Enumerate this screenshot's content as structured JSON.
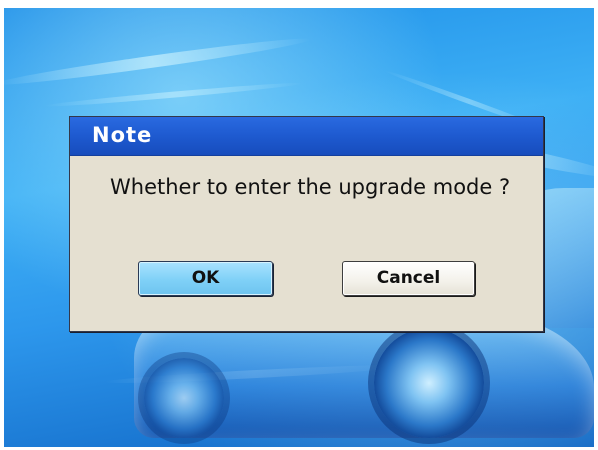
{
  "dialog": {
    "title": "Note",
    "message": "Whether to enter the upgrade mode ?",
    "buttons": {
      "ok_label": "OK",
      "cancel_label": "Cancel"
    },
    "focused_button": "ok"
  },
  "colors": {
    "titlebar": "#1e5ad0",
    "dialog_background": "#e5e0d1",
    "ok_button_focus": "#7fd0f7",
    "background_blue": "#2d97ec"
  }
}
